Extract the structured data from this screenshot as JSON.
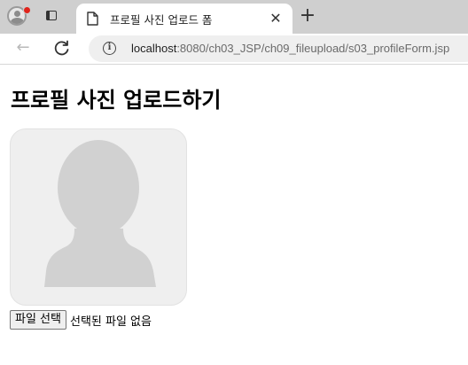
{
  "browser": {
    "tab": {
      "title": "프로필 사진 업로드 폼",
      "close_glyph": "✕"
    },
    "new_tab_glyph": "+",
    "back_glyph": "←",
    "address": {
      "host": "localhost",
      "path": ":8080/ch03_JSP/ch09_fileupload/s03_profileForm.jsp"
    },
    "info_glyph": "i"
  },
  "page": {
    "heading": "프로필 사진 업로드하기",
    "file_input": {
      "button_label": "파일 선택",
      "status": "선택된 파일 없음"
    }
  },
  "icons": {
    "profile": "profile-avatar-icon",
    "tab_actions": "tab-actions-icon",
    "favicon": "document-icon",
    "reload": "reload-icon",
    "info": "info-icon",
    "avatar_placeholder": "person-silhouette-icon"
  },
  "colors": {
    "tabstrip": "#cfcfcf",
    "notification_dot": "#e0241b",
    "avatar_background": "#efefef",
    "avatar_silhouette": "#d1d1d1"
  }
}
